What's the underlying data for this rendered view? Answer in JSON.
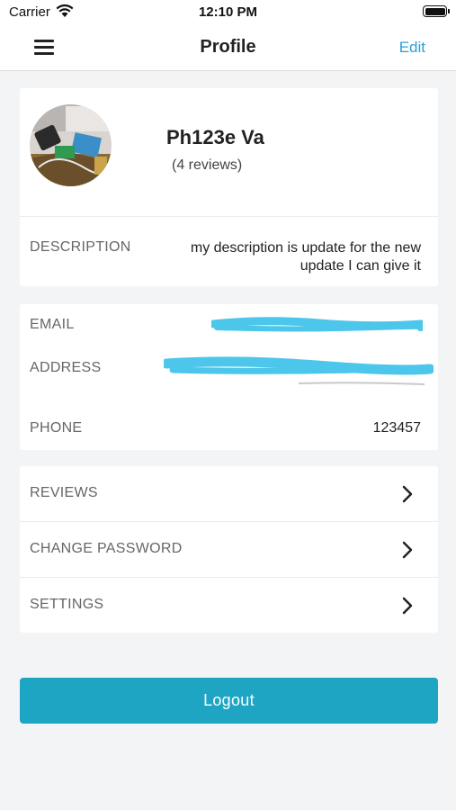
{
  "status_bar": {
    "carrier": "Carrier",
    "time": "12:10 PM"
  },
  "nav": {
    "title": "Profile",
    "edit_label": "Edit"
  },
  "profile": {
    "name": "Ph123e Va",
    "reviews": "(4 reviews)",
    "description_label": "DESCRIPTION",
    "description_value": "my description is update for the new update I can give it"
  },
  "contact": {
    "email_label": "EMAIL",
    "email_value": "",
    "address_label": "ADDRESS",
    "address_value": "",
    "phone_label": "PHONE",
    "phone_value": "123457"
  },
  "menu": {
    "items": [
      {
        "label": "REVIEWS"
      },
      {
        "label": "CHANGE PASSWORD"
      },
      {
        "label": "SETTINGS"
      }
    ]
  },
  "logout_label": "Logout",
  "colors": {
    "accent": "#2a9fd6",
    "button": "#1ea5c4",
    "redaction": "#4cc6ea"
  }
}
